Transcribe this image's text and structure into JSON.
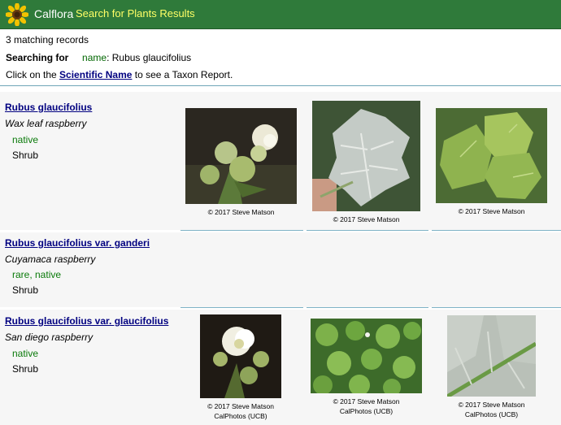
{
  "header": {
    "brand": "Calflora",
    "title": "Search for Plants Results"
  },
  "summary": {
    "count_text": "3 matching records",
    "searching_label": "Searching for",
    "field_name": "name",
    "field_value": ": Rubus glaucifolius",
    "click_prefix": "Click on the",
    "link_text": "Scientific Name",
    "click_suffix": "to see a Taxon Report."
  },
  "records": [
    {
      "scientific_name": "Rubus glaucifolius",
      "common_name": "Wax leaf raspberry",
      "status": "native",
      "habit": "Shrub",
      "photos": [
        {
          "caption": "© 2017 Steve Matson"
        },
        {
          "caption": "© 2017 Steve Matson"
        },
        {
          "caption": "© 2017 Steve Matson"
        }
      ]
    },
    {
      "scientific_name": "Rubus glaucifolius var. ganderi",
      "common_name": "Cuyamaca raspberry",
      "status": "rare, native",
      "habit": "Shrub",
      "photos": []
    },
    {
      "scientific_name": "Rubus glaucifolius var. glaucifolius",
      "common_name": "San diego raspberry",
      "status": "native",
      "habit": "Shrub",
      "photos": [
        {
          "caption": "© 2017 Steve Matson",
          "source": "CalPhotos (UCB)"
        },
        {
          "caption": "© 2017 Steve Matson",
          "source": "CalPhotos (UCB)"
        },
        {
          "caption": "© 2017 Steve Matson",
          "source": "CalPhotos (UCB)"
        }
      ]
    }
  ],
  "colors": {
    "header_bg": "#2f7a3a",
    "title_yellow": "#ffff66",
    "link_navy": "#000080",
    "status_green": "#0a7a0a"
  }
}
